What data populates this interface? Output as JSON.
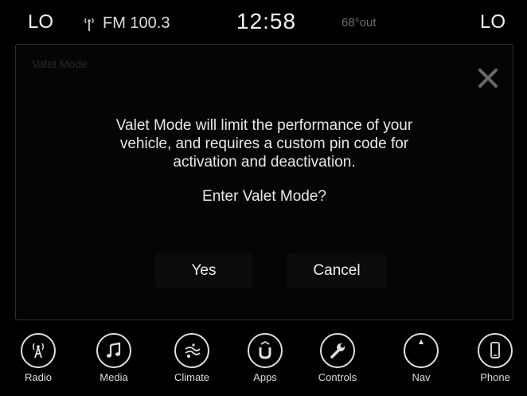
{
  "status": {
    "lo_left": "LO",
    "radio": "FM 100.3",
    "clock": "12:58",
    "temp": "68°out",
    "lo_right": "LO"
  },
  "dialog": {
    "title": "Valet Mode",
    "message_line1": "Valet Mode will limit the performance of your",
    "message_line2": "vehicle, and requires a custom pin code for",
    "message_line3": "activation and deactivation.",
    "question": "Enter Valet Mode?",
    "yes_label": "Yes",
    "cancel_label": "Cancel"
  },
  "nav": {
    "items": [
      {
        "label": "Radio",
        "icon": "radio-icon"
      },
      {
        "label": "Media",
        "icon": "media-icon"
      },
      {
        "label": "Climate",
        "icon": "climate-icon"
      },
      {
        "label": "Apps",
        "icon": "apps-icon"
      },
      {
        "label": "Controls",
        "icon": "controls-icon"
      },
      {
        "label": "Nav",
        "icon": "nav-icon"
      },
      {
        "label": "Phone",
        "icon": "phone-icon"
      }
    ]
  }
}
